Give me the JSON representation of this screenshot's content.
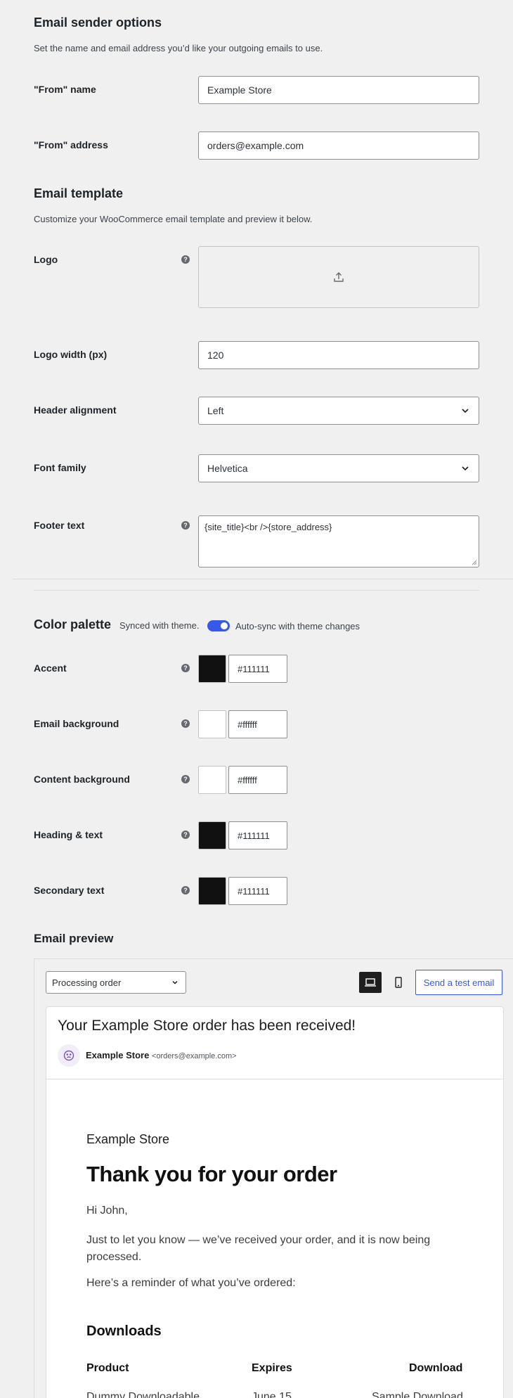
{
  "sender": {
    "title": "Email sender options",
    "description": "Set the name and email address you’d like your outgoing emails to use.",
    "from_name_label": "\"From\" name",
    "from_name_value": "Example Store",
    "from_address_label": "\"From\" address",
    "from_address_value": "orders@example.com"
  },
  "template": {
    "title": "Email template",
    "description": "Customize your WooCommerce email template and preview it below.",
    "logo_label": "Logo",
    "logo_width_label": "Logo width (px)",
    "logo_width_value": "120",
    "header_alignment_label": "Header alignment",
    "header_alignment_value": "Left",
    "font_family_label": "Font family",
    "font_family_value": "Helvetica",
    "footer_text_label": "Footer text",
    "footer_text_value": "{site_title}<br />{store_address}"
  },
  "palette": {
    "title": "Color palette",
    "synced_text": "Synced with theme.",
    "toggle_label": "Auto-sync with theme changes",
    "toggle_on": true,
    "colors": [
      {
        "label": "Accent",
        "hex": "#111111"
      },
      {
        "label": "Email background",
        "hex": "#ffffff"
      },
      {
        "label": "Content background",
        "hex": "#ffffff"
      },
      {
        "label": "Heading & text",
        "hex": "#111111"
      },
      {
        "label": "Secondary text",
        "hex": "#111111"
      }
    ]
  },
  "preview": {
    "title": "Email preview",
    "email_type": "Processing order",
    "send_test_label": "Send a test email",
    "subject": "Your Example Store order has been received!",
    "sender_name": "Example Store",
    "sender_email": "<orders@example.com>",
    "store_name": "Example Store",
    "heading": "Thank you for your order",
    "greeting": "Hi John,",
    "body": "Just to let you know — we’ve received your order, and it is now being processed.",
    "reminder": "Here’s a reminder of what you’ve ordered:",
    "downloads_title": "Downloads",
    "columns": [
      "Product",
      "Expires",
      "Download"
    ],
    "row": [
      "Dummy Downloadable",
      "June 15",
      "Sample Download"
    ]
  },
  "colors": {
    "accent_blue": "#3858e9",
    "toggle_blue": "#3858e9",
    "avatar_purple": "#7f54b3"
  }
}
